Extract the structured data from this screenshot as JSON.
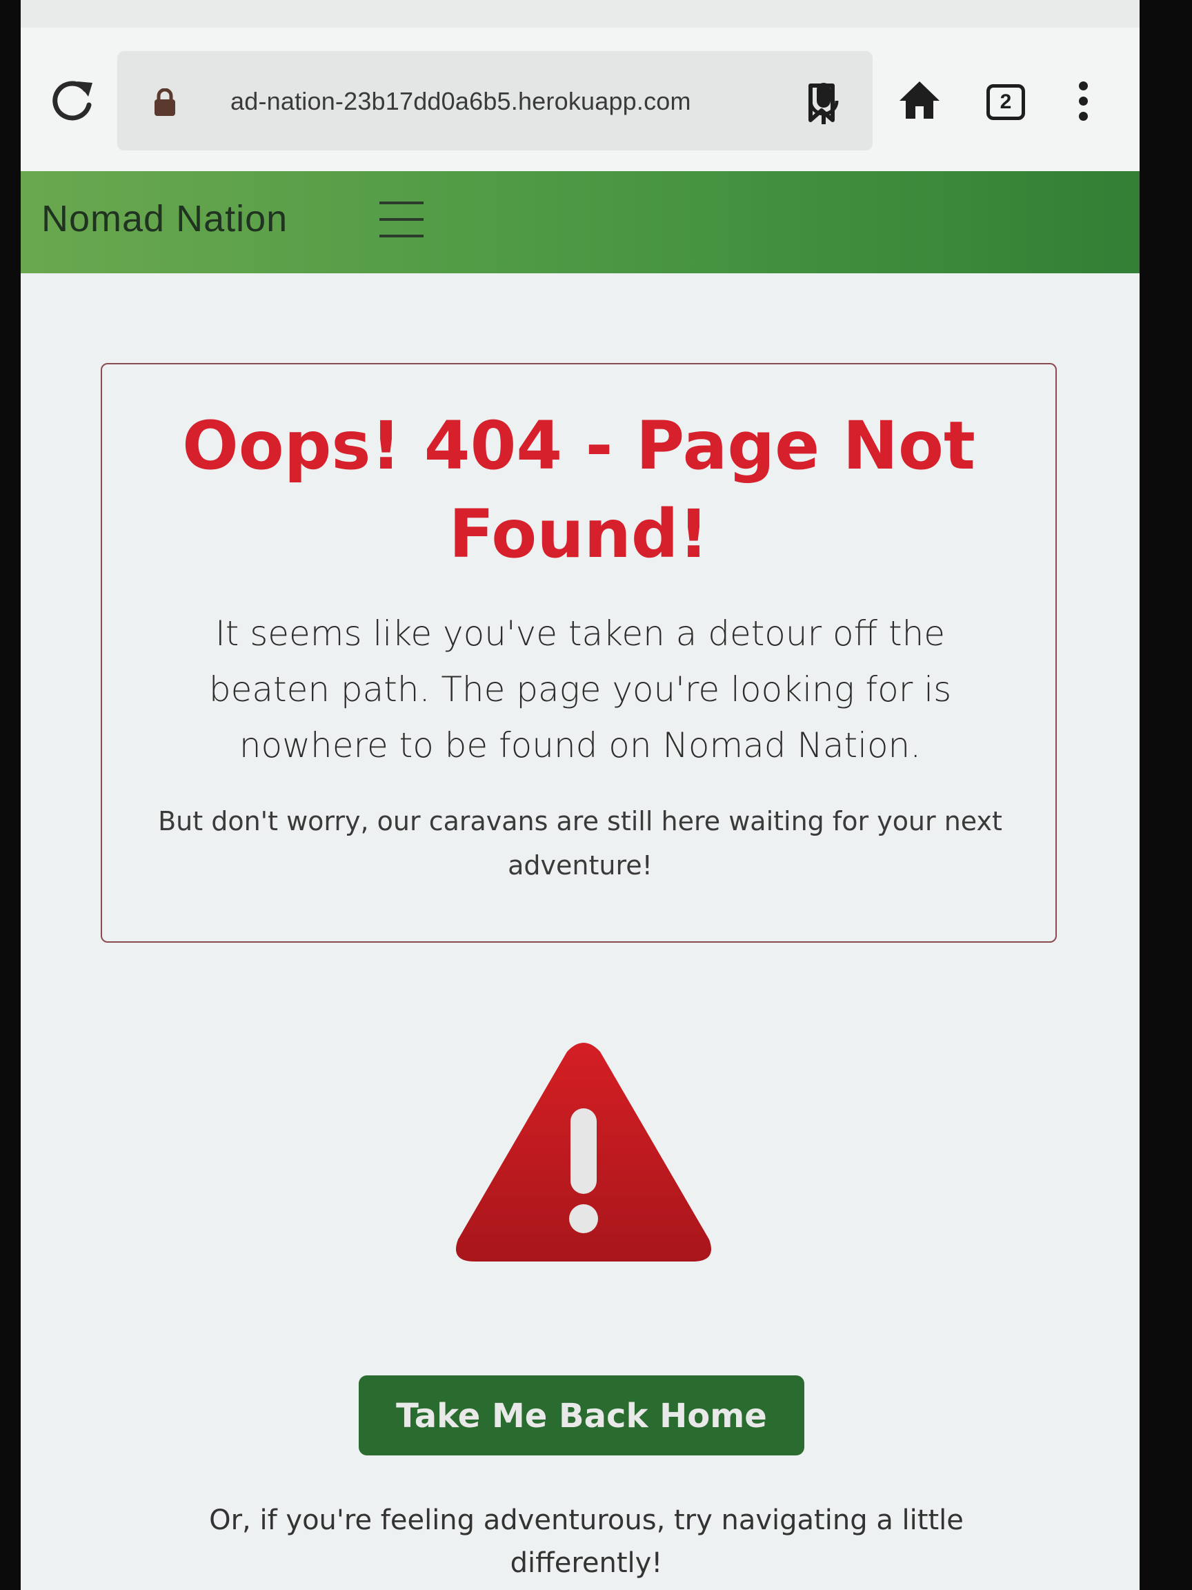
{
  "browser": {
    "url": "ad-nation-23b17dd0a6b5.herokuapp.com",
    "tab_count": "2"
  },
  "site": {
    "brand": "Nomad Nation"
  },
  "error_card": {
    "title": "Oops! 404 - Page Not Found!",
    "lead": "It seems like you've taken a detour off the beaten path. The page you're looking for is nowhere to be found on Nomad Nation.",
    "sub": "But don't worry, our caravans are still here waiting for your next adventure!"
  },
  "actions": {
    "home_button_label": "Take Me Back Home",
    "footer_note": "Or, if you're feeling adventurous, try navigating a little differently!"
  },
  "colors": {
    "accent_red": "#d6202c",
    "navbar_green": "#4f9a45",
    "button_green": "#2a6b2f"
  }
}
